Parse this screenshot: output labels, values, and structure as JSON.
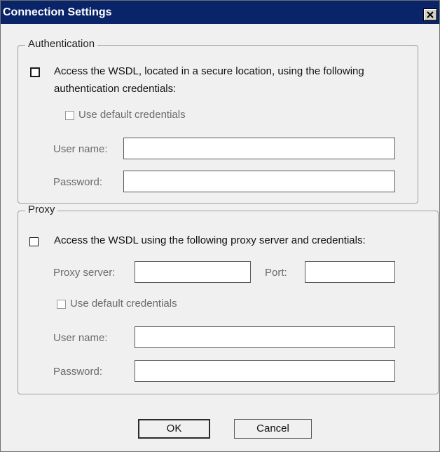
{
  "dialog": {
    "title": "Connection Settings"
  },
  "authentication": {
    "legend": "Authentication",
    "access_label_line1": "Access the WSDL, located in a secure location, using the following",
    "access_label_line2": "authentication credentials:",
    "access_checked": false,
    "use_default_label": "Use default credentials",
    "use_default_checked": false,
    "user_name_label": "User name:",
    "user_name_value": "",
    "password_label": "Password:",
    "password_value": ""
  },
  "proxy": {
    "legend": "Proxy",
    "access_label": "Access the WSDL using the following proxy server and credentials:",
    "access_checked": false,
    "proxy_server_label": "Proxy server:",
    "proxy_server_value": "",
    "port_label": "Port:",
    "port_value": "",
    "use_default_label": "Use default credentials",
    "use_default_checked": false,
    "user_name_label": "User name:",
    "user_name_value": "",
    "password_label": "Password:",
    "password_value": ""
  },
  "buttons": {
    "ok": "OK",
    "cancel": "Cancel"
  },
  "colors": {
    "titlebar": "#0a246a",
    "dialog_bg": "#f0f0f0"
  },
  "icons": {
    "close": "close-icon"
  }
}
